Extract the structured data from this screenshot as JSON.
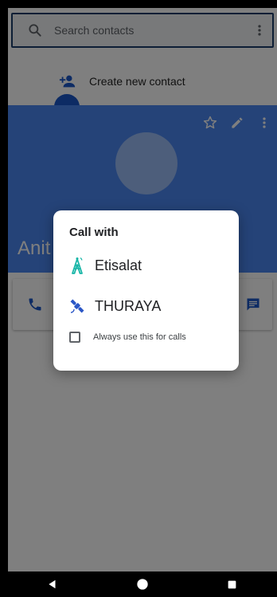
{
  "search": {
    "placeholder": "Search contacts"
  },
  "create": {
    "label": "Create new contact"
  },
  "contact": {
    "name": "Anit"
  },
  "dialog": {
    "title": "Call with",
    "options": [
      {
        "label": "Etisalat",
        "icon": "antenna-icon"
      },
      {
        "label": "THURAYA",
        "icon": "satellite-icon"
      }
    ],
    "always_label": "Always use this for calls",
    "always_checked": false
  },
  "colors": {
    "header_blue": "#4a86f0",
    "etisalat_teal": "#16b5a6",
    "thuraya_blue": "#2a56c6",
    "action_blue": "#1a57c8"
  }
}
